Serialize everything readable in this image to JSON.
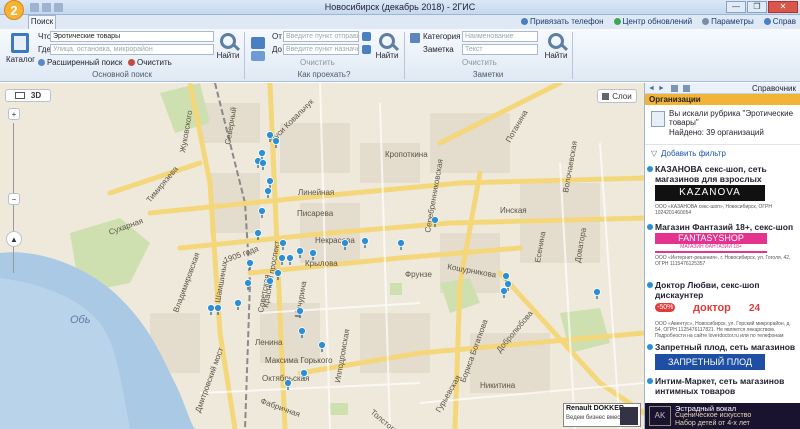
{
  "window": {
    "title": "Новосибирск (декабрь 2018) - 2ГИС",
    "logo": "2",
    "controls": [
      "—",
      "❐",
      "✕"
    ]
  },
  "tabs": [
    {
      "label": "Поиск"
    }
  ],
  "top_links": [
    {
      "label": "Привязать телефон",
      "icon": "phone-icon"
    },
    {
      "label": "Центр обновлений",
      "icon": "update-icon"
    },
    {
      "label": "Параметры",
      "icon": "settings-icon"
    },
    {
      "label": "Справ",
      "icon": "help-icon"
    }
  ],
  "basic_search": {
    "catalog_label": "Каталог",
    "what_label": "Что",
    "what_value": "Эротические товары",
    "where_label": "Где",
    "where_placeholder": "Улица, остановка, микрорайон",
    "advanced_label": "Расширенный поиск",
    "clear_label": "Очистить",
    "find_label": "Найти",
    "group_label": "Основной поиск"
  },
  "route": {
    "from_label": "От",
    "from_placeholder": "Введите пункт отправле",
    "to_label": "До",
    "to_placeholder": "Введите пункт назначен",
    "clear_label": "Очистить",
    "find_label": "Найти",
    "group_label": "Как проехать?"
  },
  "notes": {
    "category_label": "Категория",
    "category_placeholder": "Наименование",
    "note_label": "Заметка",
    "note_placeholder": "Текст",
    "clear_label": "Очистить",
    "find_label": "Найти",
    "group_label": "Заметки"
  },
  "map": {
    "view_2d": "",
    "view_3d": "3D",
    "layers_label": "Слои",
    "streets": [
      "Северный",
      "Жуковского",
      "Дуси Ковальчук",
      "Линейная",
      "Писарева",
      "Тимирязева",
      "Сухарная",
      "Нарымская",
      "Красный проспект",
      "Некрасова",
      "Крылова",
      "Кропоткина",
      "Фрунзе",
      "Кошурникова",
      "Потанина",
      "Шамшиных",
      "Ленина",
      "Максима Горького",
      "Октябрьская",
      "Советская",
      "Мичурина",
      "1905 года",
      "Обь",
      "Владимировская",
      "Дмитровский мост",
      "Фабричная",
      "Серебренниковская",
      "Гурьевская",
      "Бориса Богаткова",
      "Добролюбова",
      "Никитина",
      "Толстого",
      "Волочаевская",
      "Доватора",
      "Ипподромская",
      "Есенина",
      "Инская",
      "Ельцовская",
      "Железнодорожная",
      "Нарымская"
    ],
    "ad_bottom_left_title": "Renault DOKKER",
    "ad_bottom_left_text": "Ведем бизнес вместе"
  },
  "panel": {
    "tab_label": "Справочник",
    "header": "Организации",
    "rubric_text": "Вы искали рубрика \"Эротические товары\"",
    "found_text": "Найдено: 39 организаций",
    "add_filter": "Добавить фильтр",
    "orgs": [
      {
        "name": "КАЗАНОВА секс-шоп, сеть магазинов для взрослых",
        "brand": "KAZANOVA",
        "details": "ООО «КАЗАНОВА секс-шоп», Новосибирск, ОГРН 1024201460054"
      },
      {
        "name": "Магазин Фантазий 18+, секс-шоп",
        "brand": "FANTASYSHOP",
        "brand_sub": "МАГАЗИН ФАНТАЗИЙ 18+",
        "details": "ООО «Интернет-решения», г. Новосибирск, ул. Гоголя, 42, ОГРН 1115476125357"
      },
      {
        "name": "Доктор Любви, секс-шоп дискаунтер",
        "brand": "доктор",
        "brand_sale": "-50%",
        "brand_24": "24",
        "details": "ООО «Авентус», Новосибирск, ул. Горский микрорайон, д. 54, ОГРН 1125476117821. Не является лекарством. Подробности на сайте loverdoctor.ru или по телефонам"
      },
      {
        "name": "Запретный плод, сеть магазинов",
        "brand": "ЗАПРЕТНЫЙ ПЛОД",
        "details": ""
      },
      {
        "name": "Интим-Маркет, сеть магазинов интимных товаров",
        "brand": "",
        "details": ""
      }
    ],
    "ad_bottom_title": "Эстрадный вокал",
    "ad_bottom_sub": "Сценическое искусство",
    "ad_bottom_footer": "Набор детей от 4-х лет"
  },
  "colors": {
    "ribbon_bg": "#dfe9f4",
    "panel_header": "#f2b436",
    "map_pin": "#2b8fd6",
    "water": "#a9c9e4",
    "park": "#cfe0b0"
  }
}
